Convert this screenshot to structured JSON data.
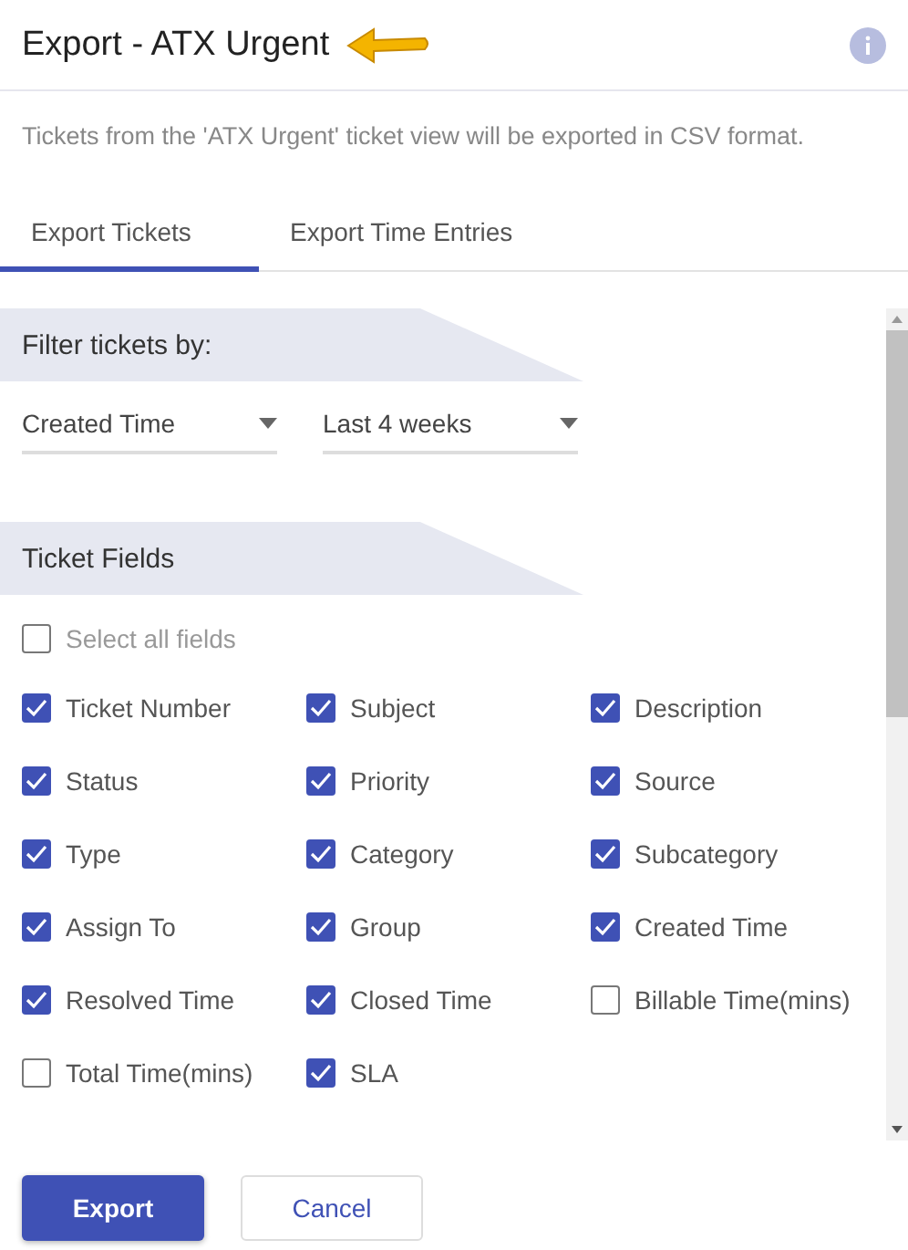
{
  "dialog": {
    "title": "Export - ATX Urgent",
    "description": "Tickets from the 'ATX Urgent' ticket view will be exported in CSV format."
  },
  "tabs": [
    {
      "label": "Export Tickets",
      "selected": true
    },
    {
      "label": "Export Time Entries",
      "selected": false
    }
  ],
  "filter": {
    "heading": "Filter tickets by:",
    "dropdowns": [
      {
        "value": "Created Time"
      },
      {
        "value": "Last 4 weeks"
      }
    ]
  },
  "ticket_fields": {
    "heading": "Ticket Fields",
    "select_all": {
      "label": "Select all fields",
      "checked": false
    },
    "fields": [
      {
        "label": "Ticket Number",
        "checked": true
      },
      {
        "label": "Subject",
        "checked": true
      },
      {
        "label": "Description",
        "checked": true
      },
      {
        "label": "Status",
        "checked": true
      },
      {
        "label": "Priority",
        "checked": true
      },
      {
        "label": "Source",
        "checked": true
      },
      {
        "label": "Type",
        "checked": true
      },
      {
        "label": "Category",
        "checked": true
      },
      {
        "label": "Subcategory",
        "checked": true
      },
      {
        "label": "Assign To",
        "checked": true
      },
      {
        "label": "Group",
        "checked": true
      },
      {
        "label": "Created Time",
        "checked": true
      },
      {
        "label": "Resolved Time",
        "checked": true
      },
      {
        "label": "Closed Time",
        "checked": true
      },
      {
        "label": "Billable Time(mins)",
        "checked": false
      },
      {
        "label": "Total Time(mins)",
        "checked": false
      },
      {
        "label": "SLA",
        "checked": true
      }
    ]
  },
  "buttons": [
    {
      "label": "Export",
      "kind": "primary"
    },
    {
      "label": "Cancel",
      "kind": "secondary"
    }
  ]
}
